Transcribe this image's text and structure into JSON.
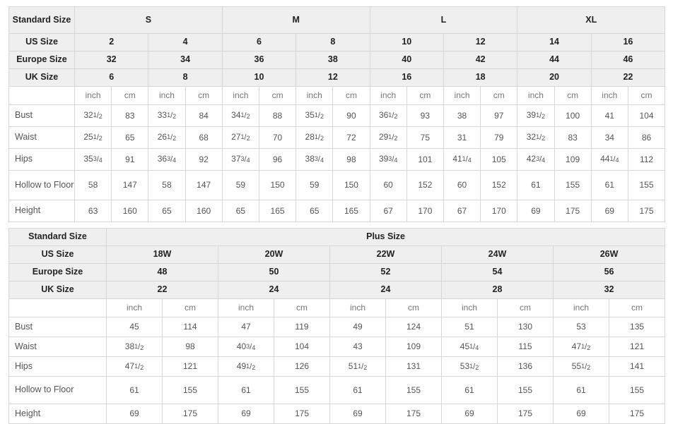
{
  "standard_table": {
    "corner_label": "Standard Size",
    "row_labels": {
      "us": "US Size",
      "europe": "Europe Size",
      "uk": "UK Size"
    },
    "groups": [
      {
        "label": "S",
        "span": 4
      },
      {
        "label": "M",
        "span": 4
      },
      {
        "label": "L",
        "span": 4
      },
      {
        "label": "XL",
        "span": 4
      }
    ],
    "us_sizes": [
      "2",
      "4",
      "6",
      "8",
      "10",
      "12",
      "14",
      "16"
    ],
    "europe_sizes": [
      "32",
      "34",
      "36",
      "38",
      "40",
      "42",
      "44",
      "46"
    ],
    "uk_sizes": [
      "6",
      "8",
      "10",
      "12",
      "16",
      "18",
      "20",
      "22"
    ],
    "units": [
      "inch",
      "cm",
      "inch",
      "cm",
      "inch",
      "cm",
      "inch",
      "cm",
      "inch",
      "cm",
      "inch",
      "cm",
      "inch",
      "cm",
      "inch",
      "cm"
    ],
    "measurements": [
      {
        "name": "Bust",
        "values": [
          {
            "whole": "32",
            "num": "1",
            "den": "2"
          },
          "83",
          {
            "whole": "33",
            "num": "1",
            "den": "2"
          },
          "84",
          {
            "whole": "34",
            "num": "1",
            "den": "2"
          },
          "88",
          {
            "whole": "35",
            "num": "1",
            "den": "2"
          },
          "90",
          {
            "whole": "36",
            "num": "1",
            "den": "2"
          },
          "93",
          "38",
          "97",
          {
            "whole": "39",
            "num": "1",
            "den": "2"
          },
          "100",
          "41",
          "104"
        ]
      },
      {
        "name": "Waist",
        "values": [
          {
            "whole": "25",
            "num": "1",
            "den": "2"
          },
          "65",
          {
            "whole": "26",
            "num": "1",
            "den": "2"
          },
          "68",
          {
            "whole": "27",
            "num": "1",
            "den": "2"
          },
          "70",
          {
            "whole": "28",
            "num": "1",
            "den": "2"
          },
          "72",
          {
            "whole": "29",
            "num": "1",
            "den": "2"
          },
          "75",
          "31",
          "79",
          {
            "whole": "32",
            "num": "1",
            "den": "2"
          },
          "83",
          "34",
          "86"
        ]
      },
      {
        "name": "Hips",
        "values": [
          {
            "whole": "35",
            "num": "3",
            "den": "4"
          },
          "91",
          {
            "whole": "36",
            "num": "3",
            "den": "4"
          },
          "92",
          {
            "whole": "37",
            "num": "3",
            "den": "4"
          },
          "96",
          {
            "whole": "38",
            "num": "3",
            "den": "4"
          },
          "98",
          {
            "whole": "39",
            "num": "3",
            "den": "4"
          },
          "101",
          {
            "whole": "41",
            "num": "1",
            "den": "4"
          },
          "105",
          {
            "whole": "42",
            "num": "3",
            "den": "4"
          },
          "109",
          {
            "whole": "44",
            "num": "1",
            "den": "4"
          },
          "112"
        ]
      },
      {
        "name": "Hollow to Floor",
        "tall": true,
        "values": [
          "58",
          "147",
          "58",
          "147",
          "59",
          "150",
          "59",
          "150",
          "60",
          "152",
          "60",
          "152",
          "61",
          "155",
          "61",
          "155"
        ]
      },
      {
        "name": "Height",
        "values": [
          "63",
          "160",
          "65",
          "160",
          "65",
          "165",
          "65",
          "165",
          "67",
          "170",
          "67",
          "170",
          "69",
          "175",
          "69",
          "175"
        ]
      }
    ]
  },
  "plus_table": {
    "corner_label": "Standard Size",
    "group_label": "Plus Size",
    "row_labels": {
      "us": "US Size",
      "europe": "Europe Size",
      "uk": "UK Size"
    },
    "us_sizes": [
      "18W",
      "20W",
      "22W",
      "24W",
      "26W"
    ],
    "europe_sizes": [
      "48",
      "50",
      "52",
      "54",
      "56"
    ],
    "uk_sizes": [
      "22",
      "24",
      "24",
      "28",
      "32"
    ],
    "units": [
      "inch",
      "cm",
      "inch",
      "cm",
      "inch",
      "cm",
      "inch",
      "cm",
      "inch",
      "cm"
    ],
    "measurements": [
      {
        "name": "Bust",
        "values": [
          "45",
          "114",
          "47",
          "119",
          "49",
          "124",
          "51",
          "130",
          "53",
          "135"
        ]
      },
      {
        "name": "Waist",
        "values": [
          {
            "whole": "38",
            "num": "1",
            "den": "2"
          },
          "98",
          {
            "whole": "40",
            "num": "3",
            "den": "4"
          },
          "104",
          "43",
          "109",
          {
            "whole": "45",
            "num": "1",
            "den": "4"
          },
          "115",
          {
            "whole": "47",
            "num": "1",
            "den": "2"
          },
          "121"
        ]
      },
      {
        "name": "Hips",
        "values": [
          {
            "whole": "47",
            "num": "1",
            "den": "2"
          },
          "121",
          {
            "whole": "49",
            "num": "1",
            "den": "2"
          },
          "126",
          {
            "whole": "51",
            "num": "1",
            "den": "2"
          },
          "131",
          {
            "whole": "53",
            "num": "1",
            "den": "2"
          },
          "136",
          {
            "whole": "55",
            "num": "1",
            "den": "2"
          },
          "141"
        ]
      },
      {
        "name": "Hollow to Floor",
        "tall": true,
        "values": [
          "61",
          "155",
          "61",
          "155",
          "61",
          "155",
          "61",
          "155",
          "61",
          "155"
        ]
      },
      {
        "name": "Height",
        "values": [
          "69",
          "175",
          "69",
          "175",
          "69",
          "175",
          "69",
          "175",
          "69",
          "175"
        ]
      }
    ]
  },
  "colors": {
    "border": "#d7d7d7",
    "header_bg": "#efefef",
    "header_text": "#222222",
    "body_text": "#555555",
    "unit_text": "#777777",
    "page_bg": "#ffffff"
  }
}
